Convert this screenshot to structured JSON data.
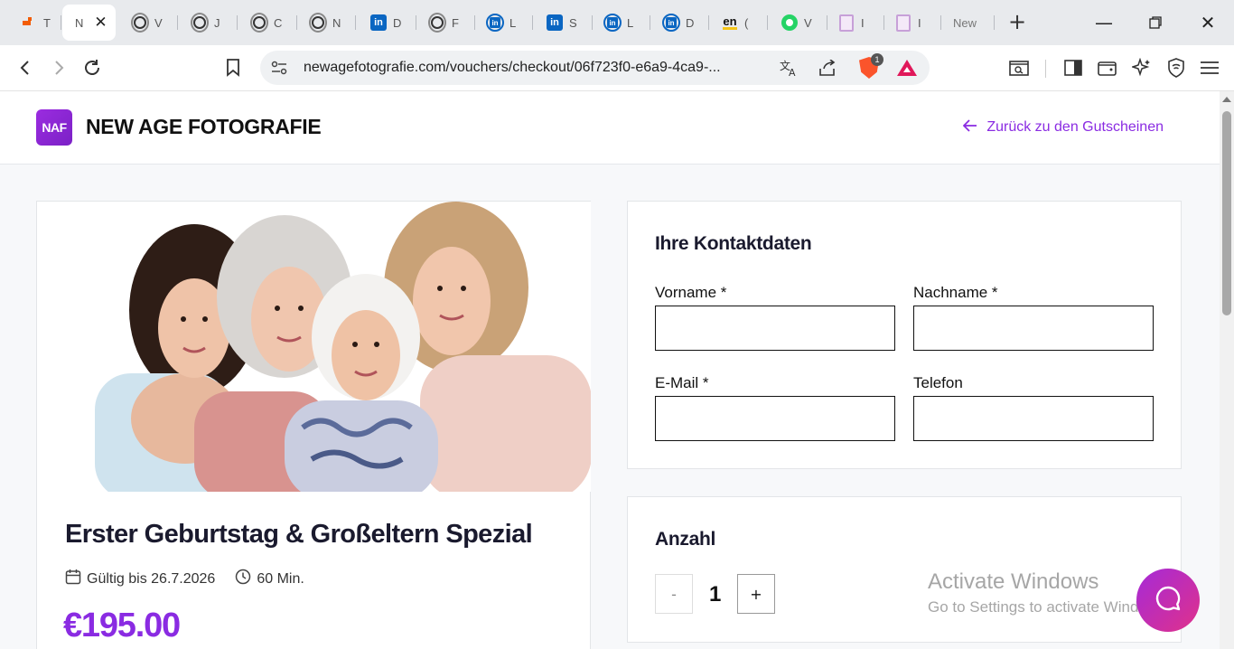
{
  "browser": {
    "tabs": [
      {
        "icon": "orange-app-icon",
        "label": "T"
      },
      {
        "icon": "site-favicon",
        "label": "N",
        "active": true
      },
      {
        "icon": "chatgpt-icon",
        "label": "V"
      },
      {
        "icon": "chatgpt-icon",
        "label": "J"
      },
      {
        "icon": "chatgpt-icon",
        "label": "C"
      },
      {
        "icon": "chatgpt-icon",
        "label": "N"
      },
      {
        "icon": "linkedin-icon",
        "label": "D"
      },
      {
        "icon": "chatgpt-icon",
        "label": "F"
      },
      {
        "icon": "linkedin-icon",
        "label": "L"
      },
      {
        "icon": "linkedin-icon",
        "label": "S"
      },
      {
        "icon": "linkedin-icon",
        "label": "L"
      },
      {
        "icon": "linkedin-icon",
        "label": "D"
      },
      {
        "icon": "english-icon",
        "label": "("
      },
      {
        "icon": "whatsapp-icon",
        "label": "V"
      },
      {
        "icon": "document-icon",
        "label": "I"
      },
      {
        "icon": "document-icon",
        "label": "I"
      },
      {
        "icon": "",
        "label": "New"
      }
    ],
    "url": "newagefotografie.com/vouchers/checkout/06f723f0-e6a9-4ca9-...",
    "brave_badge": "1"
  },
  "header": {
    "logo_text": "NAF",
    "brand_name": "NEW AGE FOTOGRAFIE",
    "back_link": "Zurück zu den Gutscheinen"
  },
  "product": {
    "title": "Erster Geburtstag & Großeltern Spezial",
    "valid_until": "Gültig bis 26.7.2026",
    "duration": "60 Min.",
    "price": "€195.00"
  },
  "contact": {
    "heading": "Ihre Kontaktdaten",
    "first_name_label": "Vorname *",
    "last_name_label": "Nachname *",
    "email_label": "E-Mail *",
    "phone_label": "Telefon",
    "first_name_value": "",
    "last_name_value": "",
    "email_value": "",
    "phone_value": ""
  },
  "quantity": {
    "heading": "Anzahl",
    "minus": "-",
    "value": "1",
    "plus": "+"
  },
  "watermark": {
    "line1": "Activate Windows",
    "line2": "Go to Settings to activate Windows."
  },
  "colors": {
    "accent": "#8a2be2",
    "text_dark": "#1a1a2e",
    "page_bg": "#f7f8fa"
  }
}
